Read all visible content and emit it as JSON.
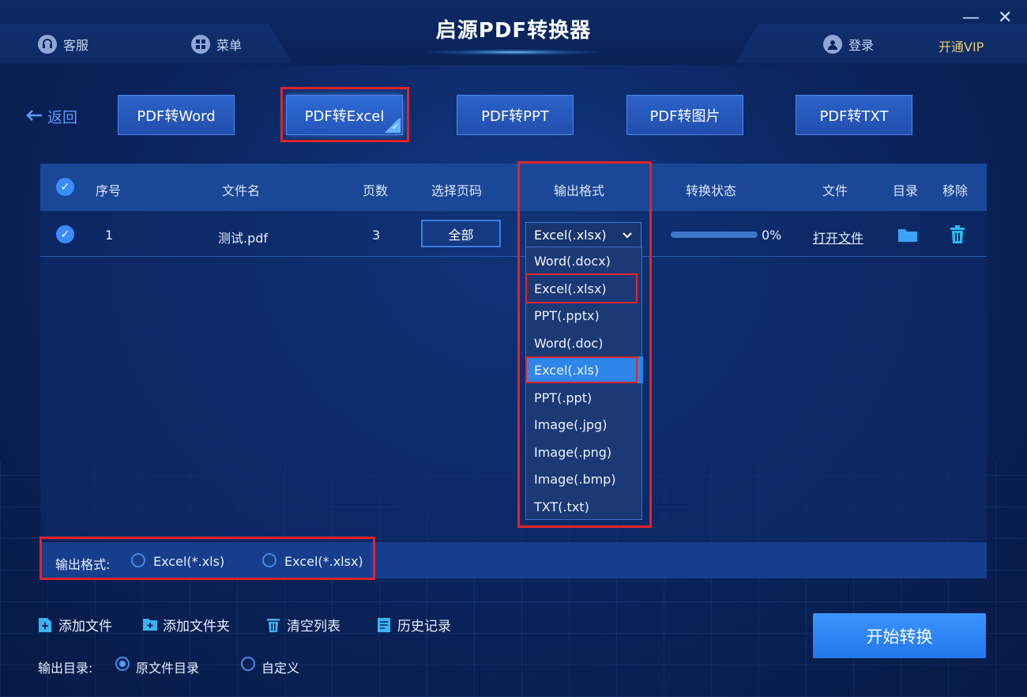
{
  "header": {
    "title": "启源PDF转换器",
    "service": "客服",
    "menu": "菜单",
    "login": "登录",
    "vip": "开通VIP",
    "minimize_glyph": "—",
    "close_glyph": "✕"
  },
  "nav": {
    "back": "返回",
    "tabs": [
      {
        "label": "PDF转Word"
      },
      {
        "label": "PDF转Excel"
      },
      {
        "label": "PDF转PPT"
      },
      {
        "label": "PDF转图片"
      },
      {
        "label": "PDF转TXT"
      }
    ],
    "active_tab": "PDF转Excel"
  },
  "table": {
    "headers": {
      "index": "序号",
      "filename": "文件名",
      "pages": "页数",
      "page_select": "选择页码",
      "output_format": "输出格式",
      "status": "转换状态",
      "file": "文件",
      "dir": "目录",
      "remove": "移除"
    },
    "rows": [
      {
        "index": "1",
        "filename": "测试.pdf",
        "pages": "3",
        "page_select": "全部",
        "output_format": "Excel(.xlsx)",
        "progress": "0%",
        "open_file": "打开文件"
      }
    ]
  },
  "format_dropdown": {
    "options": [
      "Word(.docx)",
      "Excel(.xlsx)",
      "PPT(.pptx)",
      "Word(.doc)",
      "Excel(.xls)",
      "PPT(.ppt)",
      "Image(.jpg)",
      "Image(.png)",
      "Image(.bmp)",
      "TXT(.txt)"
    ],
    "highlighted": "Excel(.xls)"
  },
  "output_format_bar": {
    "label": "输出格式:",
    "options": [
      "Excel(*.xls)",
      "Excel(*.xlsx)"
    ]
  },
  "actions": {
    "add_file": "添加文件",
    "add_folder": "添加文件夹",
    "clear_list": "清空列表",
    "history": "历史记录",
    "start": "开始转换"
  },
  "output_dir": {
    "label": "输出目录:",
    "options": [
      "原文件目录",
      "自定义"
    ],
    "selected": "原文件目录"
  },
  "colors": {
    "accent": "#3a8cff",
    "highlight_box": "#e0242a",
    "vip": "#e8c86a"
  }
}
